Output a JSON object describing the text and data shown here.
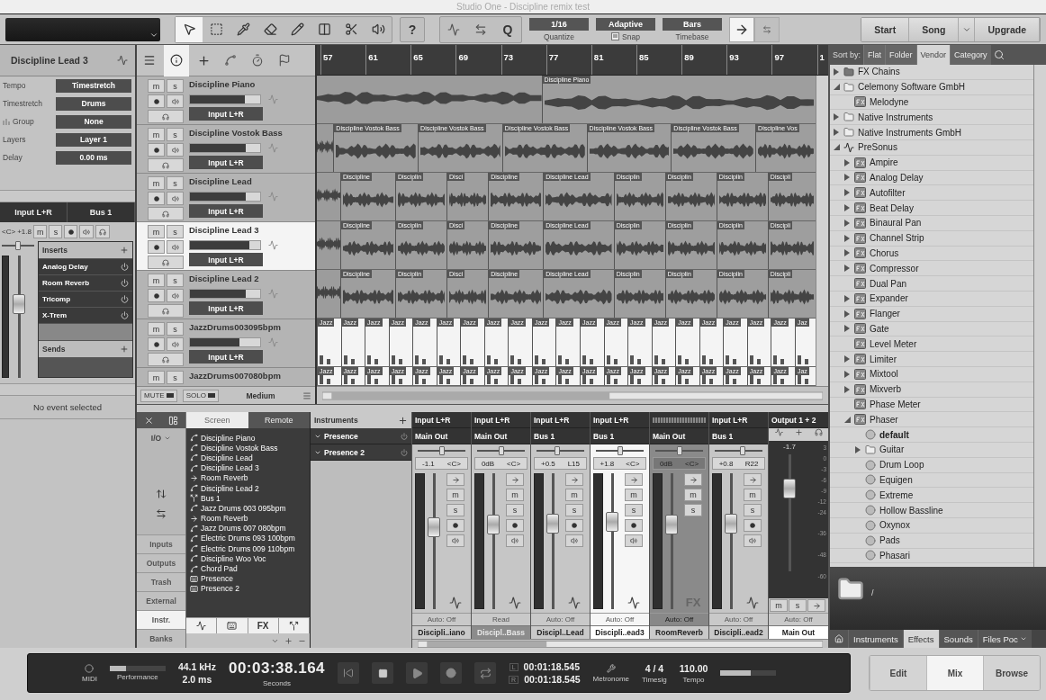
{
  "window": {
    "title": "Studio One - Discipline remix test"
  },
  "toolbar": {
    "tools": [
      {
        "kind": "arrow",
        "selected": true
      },
      {
        "kind": "range",
        "selected": false
      },
      {
        "kind": "split",
        "selected": false
      },
      {
        "kind": "eraser",
        "selected": false
      },
      {
        "kind": "pencil",
        "selected": false
      },
      {
        "kind": "mute",
        "selected": false
      },
      {
        "kind": "bend",
        "selected": false
      },
      {
        "kind": "listen",
        "selected": false
      }
    ],
    "help": "?",
    "quantize_button": "Q",
    "settings": [
      {
        "kind": "quantize",
        "value": "1/16",
        "label": "Quantize"
      },
      {
        "kind": "snap",
        "value": "Adaptive",
        "label": "Snap"
      },
      {
        "kind": "timebase",
        "value": "Bars",
        "label": "Timebase"
      }
    ],
    "follow": {
      "on": true
    },
    "nav": [
      "Start",
      "Song",
      "Upgrade"
    ]
  },
  "inspector": {
    "title": "Discipline Lead 3",
    "fields": [
      {
        "kind": "plain",
        "label": "Tempo",
        "value": "Timestretch"
      },
      {
        "kind": "plain",
        "label": "Timestretch",
        "value": "Drums"
      },
      {
        "kind": "group",
        "label": "Group",
        "value": "None"
      },
      {
        "kind": "plain",
        "label": "Layers",
        "value": "Layer 1"
      },
      {
        "kind": "plain",
        "label": "Delay",
        "value": "0.00 ms"
      }
    ],
    "input": "Input L+R",
    "output": "Bus 1",
    "pan": "<C>",
    "volume": "+1.8",
    "mute": "m",
    "solo": "s",
    "pan_slider": {
      "level": 0.5
    },
    "fader": {
      "level": 0.62
    },
    "inserts_title": "Inserts",
    "inserts": [
      "Analog Delay",
      "Room Reverb",
      "Tricomp",
      "X-Trem"
    ],
    "sends_title": "Sends",
    "event_info": "No event selected"
  },
  "tracks": [
    {
      "name": "Discipline Piano",
      "input": "Input L+R",
      "selected": false,
      "level": 0.78,
      "mute": "m",
      "solo": "s"
    },
    {
      "name": "Discipline Vostok Bass",
      "input": "Input L+R",
      "selected": false,
      "level": 0.8,
      "mute": "m",
      "solo": "s"
    },
    {
      "name": "Discipline Lead",
      "input": "Input L+R",
      "selected": false,
      "level": 0.8,
      "mute": "m",
      "solo": "s"
    },
    {
      "name": "Discipline Lead 3",
      "input": "Input L+R",
      "selected": true,
      "level": 0.84,
      "mute": "m",
      "solo": "s"
    },
    {
      "name": "Discipline Lead 2",
      "input": "Input L+R",
      "selected": false,
      "level": 0.8,
      "mute": "m",
      "solo": "s"
    },
    {
      "name": "JazzDrums003095bpm",
      "input": "Input L+R",
      "selected": false,
      "level": 0.7,
      "mute": "m",
      "solo": "s"
    },
    {
      "name": "JazzDrums007080bpm",
      "selected": false,
      "mute": "m",
      "solo": "s"
    }
  ],
  "track_footer": {
    "mute": "MUTE",
    "solo": "SOLO",
    "size": "Medium"
  },
  "ruler": [
    "57",
    "61",
    "65",
    "69",
    "73",
    "77",
    "81",
    "85",
    "89",
    "93",
    "97",
    "1"
  ],
  "lanes": [
    {
      "kind": "audio",
      "clips": [
        "Discipline Piano"
      ]
    },
    {
      "kind": "audio",
      "clips": [
        "Discipline Vostok Bass",
        "Discipline Vostok Bass",
        "Discipline Vostok Bass",
        "Discipline Vostok Bass",
        "Discipline Vostok Bass",
        "Discipline Vos"
      ]
    },
    {
      "kind": "audio",
      "clips": [
        "Discipline",
        "Disciplin",
        "Disci",
        "Discipline",
        "Discipline Lead",
        "Disciplin",
        "Disciplin",
        "Disciplin",
        "Discipli"
      ]
    },
    {
      "kind": "audio",
      "clips": [
        "Discipline",
        "Disciplin",
        "Disci",
        "Discipline",
        "Discipline Lead",
        "Disciplin",
        "Disciplin",
        "Disciplin",
        "Discipli"
      ]
    },
    {
      "kind": "audio",
      "clips": [
        "Discipline",
        "Disciplin",
        "Disci",
        "Discipline",
        "Discipline Lead",
        "Disciplin",
        "Disciplin",
        "Disciplin",
        "Discipli"
      ]
    },
    {
      "kind": "drums",
      "clips": [
        "Jazz",
        "Jazz",
        "Jazz",
        "Jazz",
        "Jazz",
        "Jazz",
        "Jazz",
        "Jazz",
        "Jazz",
        "Jazz",
        "Jazz",
        "Jazz",
        "Jazz",
        "Jazz",
        "Jazz",
        "Jazz",
        "Jazz",
        "Jazz",
        "Jazz",
        "Jazz",
        "Jaz"
      ]
    },
    {
      "kind": "drums",
      "clips": [
        "Jazz",
        "Jazz",
        "Jazz",
        "Jazz",
        "Jazz",
        "Jazz",
        "Jazz",
        "Jazz",
        "Jazz",
        "Jazz",
        "Jazz",
        "Jazz",
        "Jazz",
        "Jazz",
        "Jazz",
        "Jazz",
        "Jazz",
        "Jazz",
        "Jazz",
        "Jazz",
        "Jaz"
      ]
    }
  ],
  "mixer": {
    "io": "I/O",
    "nav": [
      {
        "label": "Inputs",
        "selected": false
      },
      {
        "label": "Outputs",
        "selected": false
      },
      {
        "label": "Trash",
        "selected": false
      },
      {
        "label": "External",
        "selected": false
      },
      {
        "label": "Instr.",
        "selected": true
      },
      {
        "label": "Banks",
        "selected": false
      }
    ],
    "tabs": [
      {
        "label": "Screen",
        "selected": true
      },
      {
        "label": "Remote",
        "selected": false
      }
    ],
    "channels": [
      {
        "kind": "audio",
        "name": "Discipline Piano"
      },
      {
        "kind": "audio",
        "name": "Discipline Vostok Bass"
      },
      {
        "kind": "audio",
        "name": "Discipline Lead"
      },
      {
        "kind": "audio",
        "name": "Discipline Lead 3"
      },
      {
        "kind": "fx",
        "name": "Room Reverb"
      },
      {
        "kind": "audio",
        "name": "Discipline Lead 2"
      },
      {
        "kind": "bus",
        "name": "Bus 1"
      },
      {
        "kind": "audio",
        "name": "Jazz Drums 003 095bpm"
      },
      {
        "kind": "fx",
        "name": "Room Reverb"
      },
      {
        "kind": "audio",
        "name": "Jazz Drums 007 080bpm"
      },
      {
        "kind": "audio",
        "name": "Electric Drums 093 100bpm"
      },
      {
        "kind": "audio",
        "name": "Electric Drums 009 110bpm"
      },
      {
        "kind": "audio",
        "name": "Discipline Woo Voc"
      },
      {
        "kind": "audio",
        "name": "Chord Pad"
      },
      {
        "kind": "instrument",
        "name": "Presence"
      },
      {
        "kind": "instrument",
        "name": "Presence 2"
      }
    ],
    "filter_fx": "FX",
    "instruments": {
      "title": "Instruments",
      "items": [
        "Presence",
        "Presence 2"
      ]
    },
    "strips": [
      {
        "kind": "audio",
        "input": "Input L+R",
        "output": "Main Out",
        "volume": "-1.1",
        "pan": "<C>",
        "pan_slider": {
          "level": 0.5
        },
        "fader": {
          "level": 0.62
        },
        "auto": "Auto: Off",
        "name": "Discipli..iano",
        "selected": false,
        "name_marked": false,
        "mute": "m",
        "solo": "s"
      },
      {
        "kind": "audio",
        "input": "Input L+R",
        "output": "Main Out",
        "volume": "0dB",
        "pan": "<C>",
        "pan_slider": {
          "level": 0.5
        },
        "fader": {
          "level": 0.64
        },
        "auto": "Read",
        "name": "Discipl..Bass",
        "selected": false,
        "name_marked": true,
        "mute": "m",
        "solo": "s"
      },
      {
        "kind": "audio",
        "input": "Input L+R",
        "output": "Bus 1",
        "volume": "+0.5",
        "pan": "L15",
        "pan_slider": {
          "level": 0.42
        },
        "fader": {
          "level": 0.65
        },
        "auto": "Auto: Off",
        "name": "Discipl..Lead",
        "selected": false,
        "name_marked": false,
        "mute": "m",
        "solo": "s"
      },
      {
        "kind": "audio",
        "input": "Input L+R",
        "output": "Bus 1",
        "volume": "+1.8",
        "pan": "<C>",
        "pan_slider": {
          "level": 0.5
        },
        "fader": {
          "level": 0.67
        },
        "auto": "Auto: Off",
        "name": "Discipli..ead3",
        "selected": true,
        "name_marked": false,
        "mute": "m",
        "solo": "s"
      },
      {
        "kind": "fx",
        "output": "Main Out",
        "volume": "0dB",
        "pan": "<C>",
        "pan_slider": {
          "level": 0.5
        },
        "fader": {
          "level": 0.64
        },
        "auto": "Auto: Off",
        "name": "RoomReverb",
        "selected": false,
        "name_marked": false,
        "mute": "m",
        "solo": "s",
        "badge": "FX"
      },
      {
        "kind": "audio",
        "input": "Input L+R",
        "output": "Bus 1",
        "volume": "+0.8",
        "pan": "R22",
        "pan_slider": {
          "level": 0.6
        },
        "fader": {
          "level": 0.65
        },
        "auto": "Auto: Off",
        "name": "Discipli..ead2",
        "selected": false,
        "name_marked": false,
        "mute": "m",
        "solo": "s"
      }
    ],
    "output": {
      "title": "Output 1 + 2",
      "volume": "-1.7",
      "scale": [
        "3",
        "0",
        "-3",
        "-6",
        "-9",
        "-12",
        "-24",
        "-36",
        "-48",
        "-60"
      ],
      "fader": {
        "level": 0.75
      },
      "mute": "m",
      "solo": "s",
      "auto": "Auto: Off",
      "name": "Main Out"
    }
  },
  "browser": {
    "sort_label": "Sort by:",
    "sort_tabs": [
      {
        "label": "Flat",
        "selected": false
      },
      {
        "label": "Folder",
        "selected": false
      },
      {
        "label": "Vendor",
        "selected": true
      },
      {
        "label": "Category",
        "selected": false
      }
    ],
    "tree": [
      {
        "label": "FX Chains",
        "kind": "chains",
        "expanded": false
      },
      {
        "label": "Celemony Software GmbH",
        "kind": "folder",
        "expanded": true,
        "children": [
          {
            "label": "Melodyne",
            "kind": "plugin"
          }
        ]
      },
      {
        "label": "Native Instruments",
        "kind": "folder",
        "expanded": false
      },
      {
        "label": "Native Instruments GmbH",
        "kind": "folder",
        "expanded": false
      },
      {
        "label": "PreSonus",
        "kind": "vendor",
        "expanded": true,
        "children": [
          {
            "label": "Ampire",
            "kind": "plugin",
            "expanded": false
          },
          {
            "label": "Analog Delay",
            "kind": "plugin",
            "expanded": false
          },
          {
            "label": "Autofilter",
            "kind": "plugin",
            "expanded": false
          },
          {
            "label": "Beat Delay",
            "kind": "plugin",
            "expanded": false
          },
          {
            "label": "Binaural Pan",
            "kind": "plugin",
            "expanded": false
          },
          {
            "label": "Channel Strip",
            "kind": "plugin",
            "expanded": false
          },
          {
            "label": "Chorus",
            "kind": "plugin",
            "expanded": false
          },
          {
            "label": "Compressor",
            "kind": "plugin",
            "expanded": false
          },
          {
            "label": "Dual Pan",
            "kind": "plugin"
          },
          {
            "label": "Expander",
            "kind": "plugin",
            "expanded": false
          },
          {
            "label": "Flanger",
            "kind": "plugin",
            "expanded": false
          },
          {
            "label": "Gate",
            "kind": "plugin",
            "expanded": false
          },
          {
            "label": "Level Meter",
            "kind": "plugin"
          },
          {
            "label": "Limiter",
            "kind": "plugin",
            "expanded": false
          },
          {
            "label": "Mixtool",
            "kind": "plugin",
            "expanded": false
          },
          {
            "label": "Mixverb",
            "kind": "plugin",
            "expanded": false
          },
          {
            "label": "Phase Meter",
            "kind": "plugin"
          },
          {
            "label": "Phaser",
            "kind": "plugin",
            "expanded": true,
            "children": [
              {
                "label": "default",
                "kind": "preset",
                "selected": true
              },
              {
                "label": "Guitar",
                "kind": "folder",
                "expanded": false,
                "selected": false
              },
              {
                "label": "Drum Loop",
                "kind": "preset",
                "selected": false
              },
              {
                "label": "Equigen",
                "kind": "preset",
                "selected": false
              },
              {
                "label": "Extreme",
                "kind": "preset",
                "selected": false
              },
              {
                "label": "Hollow Bassline",
                "kind": "preset",
                "selected": false
              },
              {
                "label": "Oxynox",
                "kind": "preset",
                "selected": false
              },
              {
                "label": "Pads",
                "kind": "preset",
                "selected": false
              },
              {
                "label": "Phasari",
                "kind": "preset",
                "selected": false
              }
            ]
          }
        ]
      }
    ],
    "path": "/",
    "tabs": [
      {
        "label": "Instruments",
        "selected": false
      },
      {
        "label": "Effects",
        "selected": true
      },
      {
        "label": "Sounds",
        "selected": false
      },
      {
        "label": "Files Poc",
        "selected": false
      }
    ]
  },
  "transport": {
    "midi": "MIDI",
    "performance": "Performance",
    "performance_meter": {
      "level": 0.3
    },
    "sample_rate": "44.1 kHz",
    "latency": "2.0 ms",
    "time": "00:03:38.164",
    "time_unit": "Seconds",
    "controls": [
      {
        "kind": "rewind"
      },
      {
        "kind": "stop"
      },
      {
        "kind": "play"
      },
      {
        "kind": "record"
      },
      {
        "kind": "loop"
      }
    ],
    "left_label": "L",
    "left_time": "00:01:18.545",
    "right_label": "R",
    "right_time": "00:01:18.545",
    "metronome": "Metronome",
    "timesig": "4 / 4",
    "timesig_label": "Timesig",
    "tempo": "110.00",
    "tempo_label": "Tempo",
    "output_meter": {
      "level": 0.55
    },
    "views": [
      {
        "label": "Edit",
        "selected": false
      },
      {
        "label": "Mix",
        "selected": true
      },
      {
        "label": "Browse",
        "selected": false
      }
    ]
  }
}
